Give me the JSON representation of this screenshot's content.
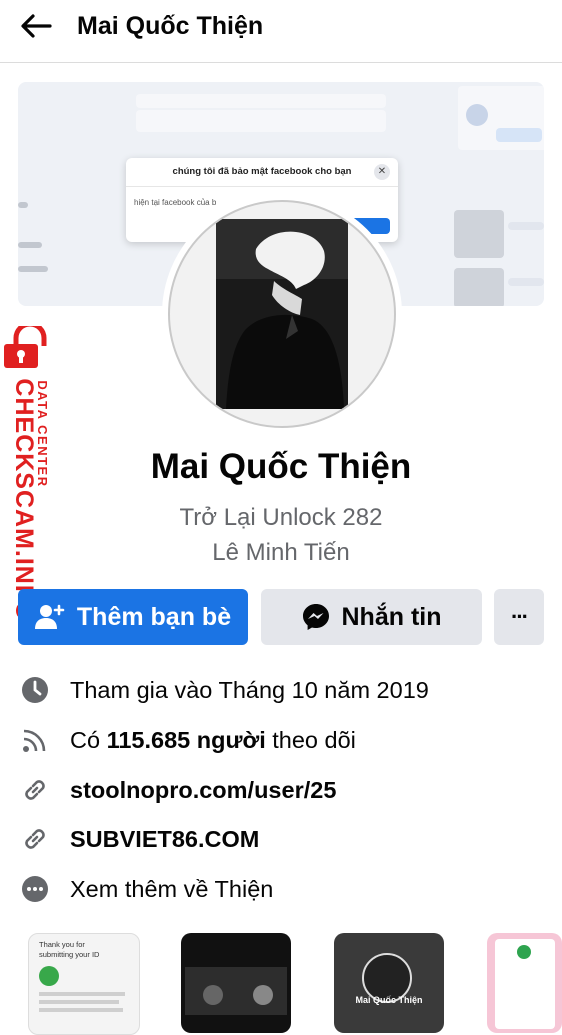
{
  "header": {
    "title": "Mai Quốc Thiện",
    "back_icon": "arrow-left-icon"
  },
  "cover": {
    "dialog_title": "chúng tôi đã bảo mật facebook cho bạn",
    "dialog_body": "hiện tại facebook của b"
  },
  "watermark": {
    "line1": "DATA CENTER",
    "line2": "CHECKSCAM.INFO",
    "color": "#e02020"
  },
  "profile": {
    "name": "Mai Quốc Thiện",
    "subtitle_1": "Trở Lại Unlock 282",
    "subtitle_2": "Lê Minh Tiến"
  },
  "actions": {
    "add_friend_label": "Thêm bạn bè",
    "message_label": "Nhắn tin",
    "more_label": "···"
  },
  "info": {
    "joined": "Tham gia vào Tháng 10 năm 2019",
    "followers_prefix": "Có ",
    "followers_bold": "115.685 người",
    "followers_suffix": " theo dõi",
    "link_1": "stoolnopro.com/user/25",
    "link_2": "SUBVIET86.COM",
    "see_more": "Xem thêm về Thiện"
  },
  "thumbs": {
    "t1_text": "Thank you for submitting your ID",
    "t3_text": "Mai Quốc Thiện"
  },
  "colors": {
    "primary_blue": "#1b74e4",
    "secondary_gray": "#e4e6eb",
    "text_gray": "#65676b"
  }
}
